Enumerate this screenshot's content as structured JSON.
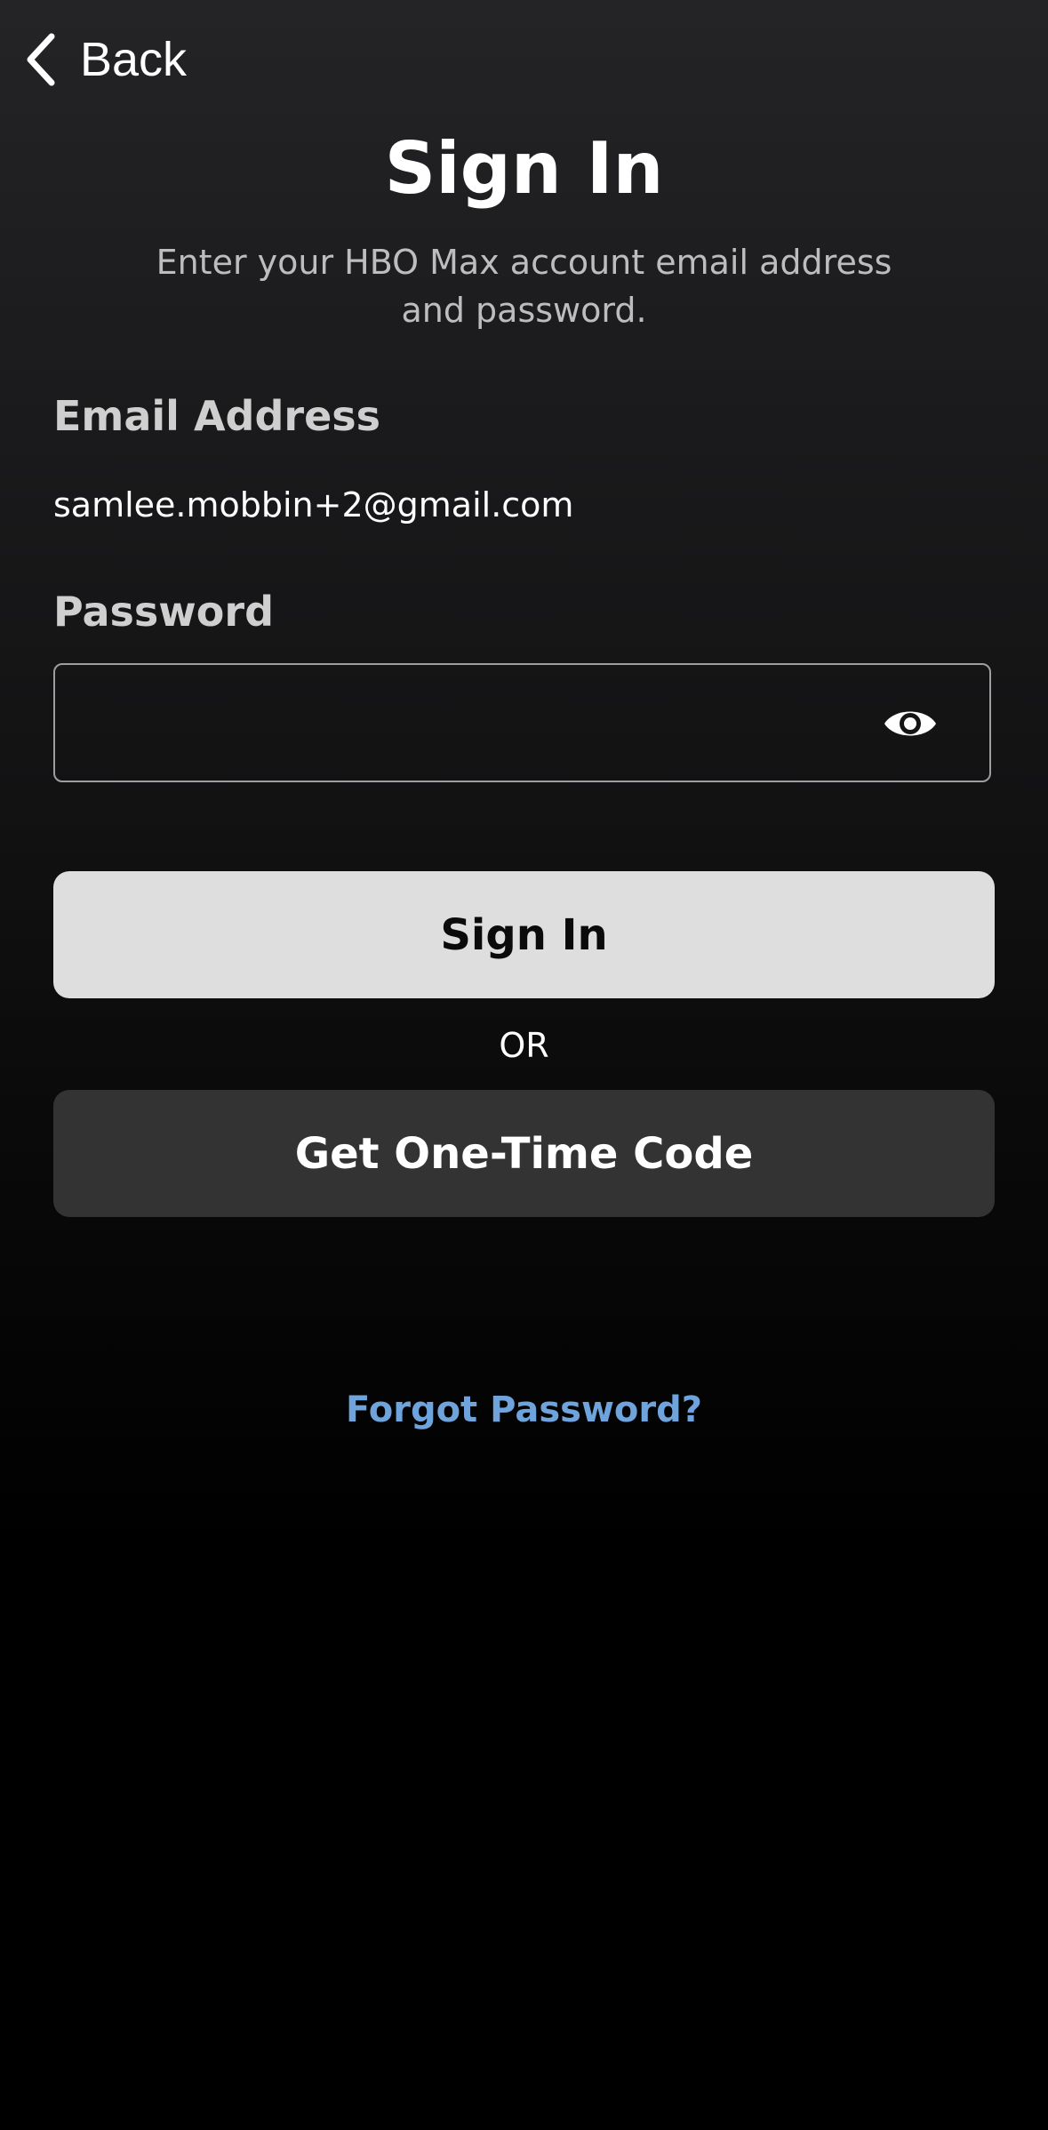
{
  "colors": {
    "background": "#000000",
    "primary_button_bg": "#dedede",
    "secondary_button_bg": "#333334",
    "link": "#6fa3dc",
    "field_border": "#9e9e9e"
  },
  "nav": {
    "back_label": "Back",
    "back_icon": "chevron-left-icon"
  },
  "header": {
    "title": "Sign In",
    "subtitle": "Enter your HBO Max account email address and password."
  },
  "form": {
    "email_label": "Email Address",
    "email_value": "samlee.mobbin+2@gmail.com",
    "password_label": "Password",
    "password_value": "",
    "password_visibility_icon": "eye-icon"
  },
  "actions": {
    "sign_in_label": "Sign In",
    "or_label": "OR",
    "one_time_code_label": "Get One-Time Code",
    "forgot_password_label": "Forgot Password?"
  }
}
